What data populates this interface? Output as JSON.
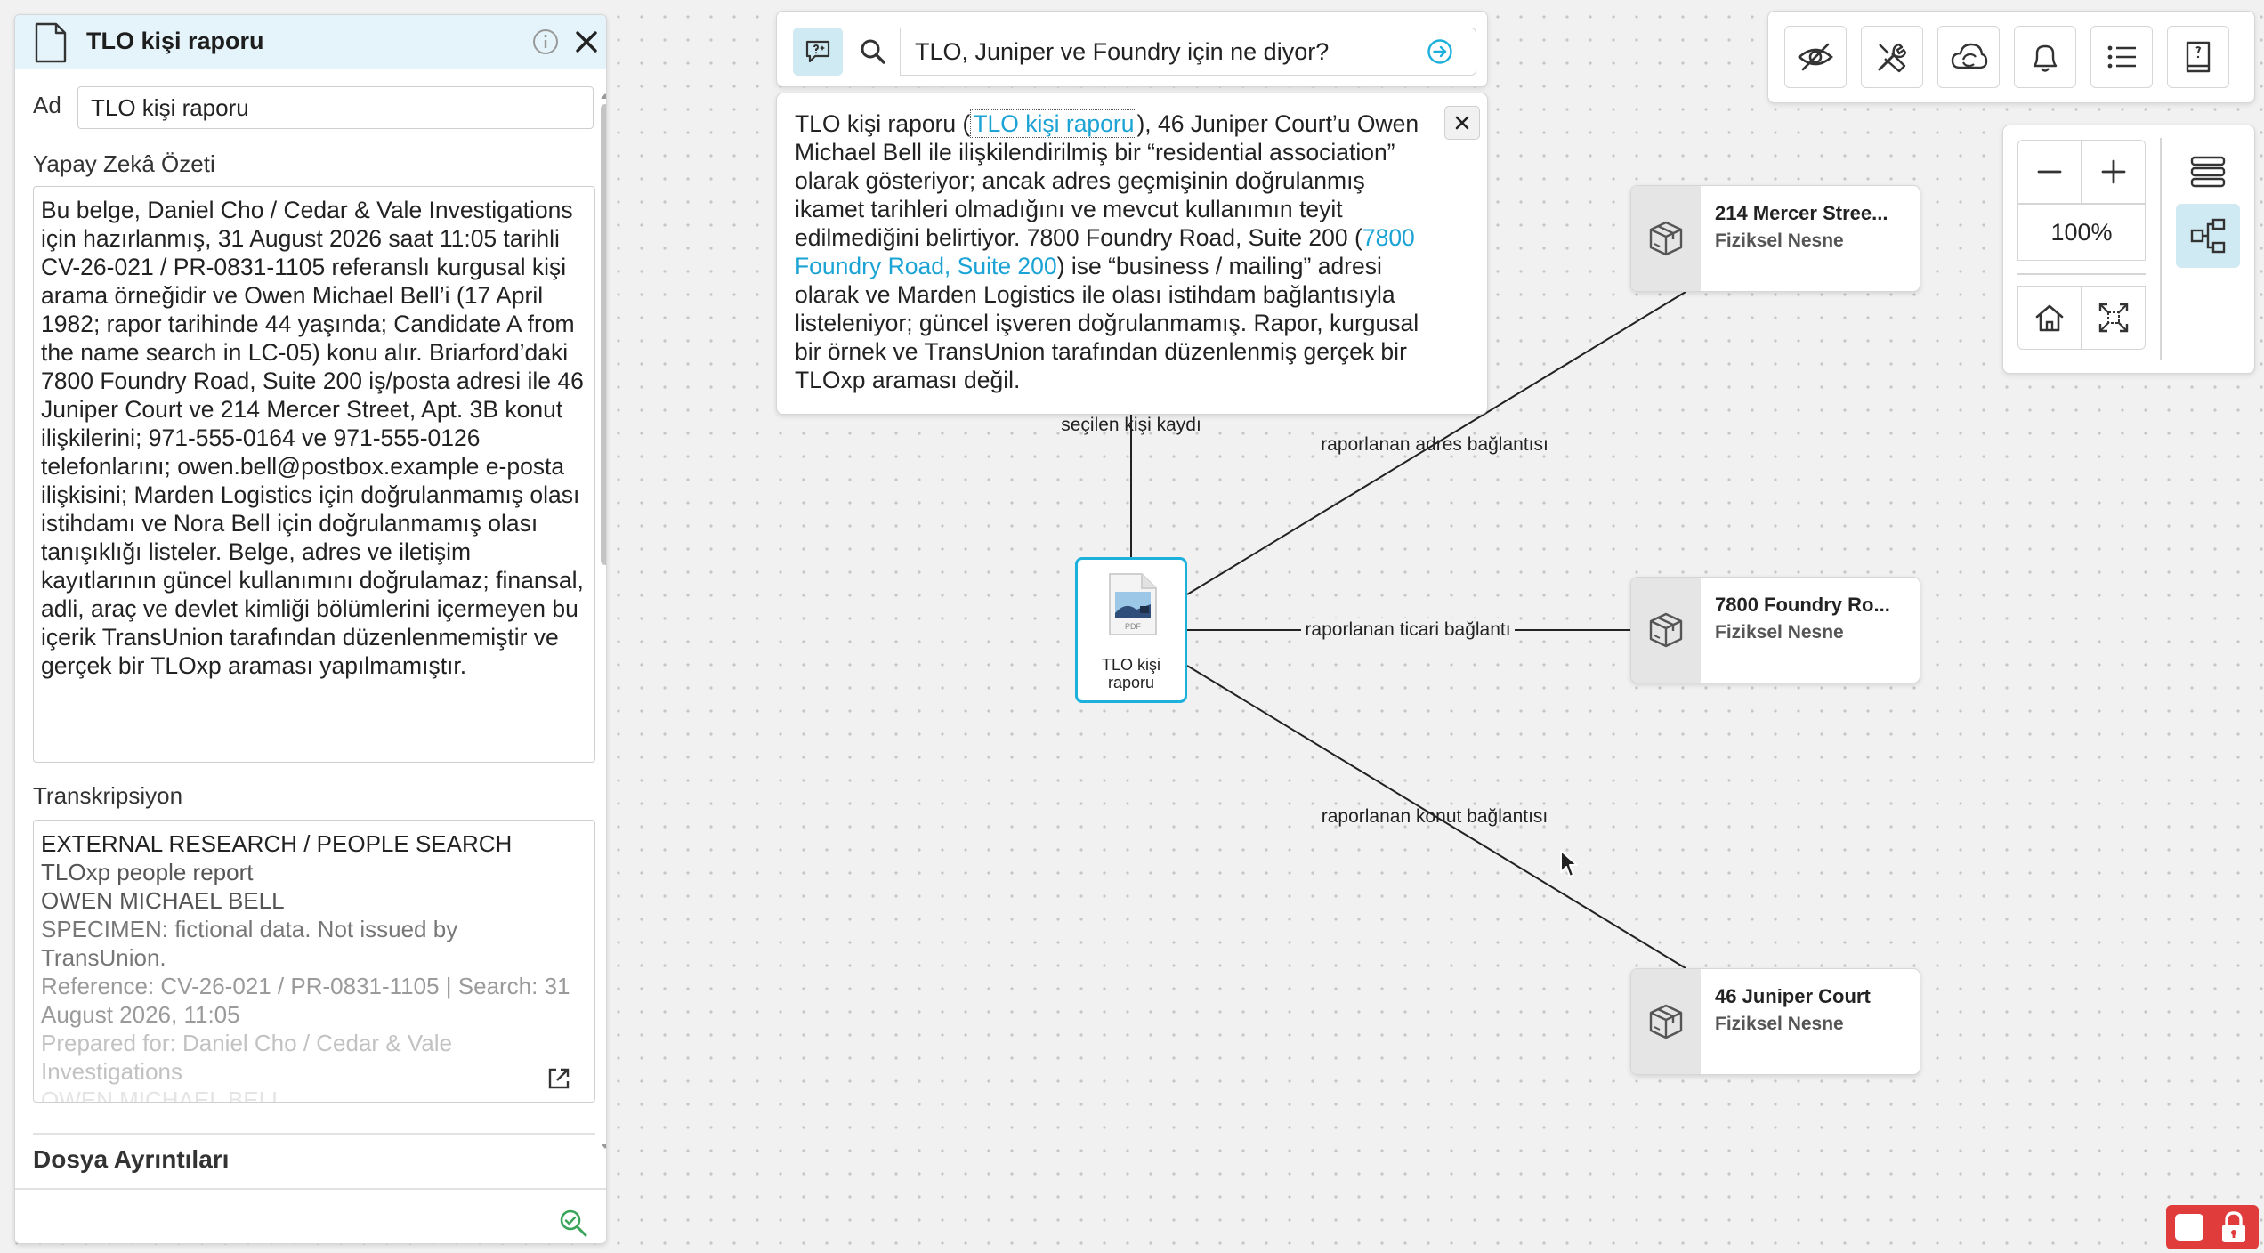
{
  "panel": {
    "title": "TLO kişi raporu",
    "name_label": "Ad",
    "name_value": "TLO kişi raporu",
    "summary_label": "Yapay Zekâ Özeti",
    "summary_text": "Bu belge, Daniel Cho / Cedar & Vale Investigations için hazırlanmış, 31 August 2026 saat 11:05 tarihli CV-26-021 / PR-0831-1105 referanslı kurgusal kişi arama örneğidir ve Owen Michael Bell’i (17 April 1982; rapor tarihinde 44 yaşında; Candidate A from the name search in LC-05) konu alır. Briarford’daki 7800 Foundry Road, Suite 200 iş/posta adresi ile 46 Juniper Court ve 214 Mercer Street, Apt. 3B konut ilişkilerini; 971-555-0164 ve 971-555-0126 telefonlarını; owen.bell@postbox.example e-posta ilişkisini; Marden Logistics için doğrulanmamış olası istihdamı ve Nora Bell için doğrulanmamış olası tanışıklığı listeler. Belge, adres ve iletişim kayıtlarının güncel kullanımını doğrulamaz; finansal, adli, araç ve devlet kimliği bölümlerini içermeyen bu içerik TransUnion tarafından düzenlenmemiştir ve gerçek bir TLOxp araması yapılmamıştır.",
    "transcript_label": "Transkripsiyon",
    "transcript_lines": [
      "EXTERNAL RESEARCH / PEOPLE SEARCH",
      "TLOxp people report",
      "OWEN MICHAEL BELL",
      "SPECIMEN: fictional data. Not issued by TransUnion.",
      "Reference: CV-26-021 / PR-0831-1105 | Search: 31 August 2026, 11:05",
      "Prepared for: Daniel Cho / Cedar & Vale Investigations",
      "OWEN MICHAEL BELL"
    ],
    "file_details_label": "Dosya Ayrıntıları"
  },
  "search": {
    "query": "TLO, Juniper ve Foundry için ne diyor?",
    "answer": {
      "p1": "TLO kişi raporu (",
      "link1": "TLO kişi raporu",
      "p2": "), 46 Juniper Court’u Owen Michael Bell ile ilişkilendirilmiş bir “residential association” olarak gösteriyor; ancak adres geçmişinin doğrulanmış ikamet tarihleri olmadığını ve mevcut kullanımın teyit edilmediğini belirtiyor. 7800 Foundry Road, Suite 200 (",
      "link2": "7800 Foundry Road, Suite 200",
      "p3": ") ise “business / mailing” adresi olarak ve Marden Logistics ile olası istihdam bağlantısıyla listeleniyor; güncel işveren doğrulanmamış. Rapor, kurgusal bir örnek ve TransUnion tarafından düzenlenmiş gerçek bir TLOxp araması değil."
    }
  },
  "graph": {
    "center": {
      "label": "TLO kişi raporu"
    },
    "edges": {
      "selected": "seçilen kişi kaydı",
      "address": "raporlanan adres bağlantısı",
      "business": "raporlanan ticari bağlantı",
      "residential": "raporlanan konut bağlantısı"
    },
    "nodes": [
      {
        "title": "214 Mercer Stree...",
        "type": "Fiziksel Nesne"
      },
      {
        "title": "7800 Foundry Ro...",
        "type": "Fiziksel Nesne"
      },
      {
        "title": "46 Juniper Court",
        "type": "Fiziksel Nesne"
      }
    ]
  },
  "toolbar": {
    "icons": [
      "eye-off-icon",
      "tools-icon",
      "cloud-sync-icon",
      "bell-icon",
      "list-icon",
      "book-icon"
    ]
  },
  "zoom": {
    "level": "100%"
  },
  "colors": {
    "accent": "#1cb0dc",
    "accent_light": "#cfeaf2",
    "lock": "#e03c3c"
  }
}
